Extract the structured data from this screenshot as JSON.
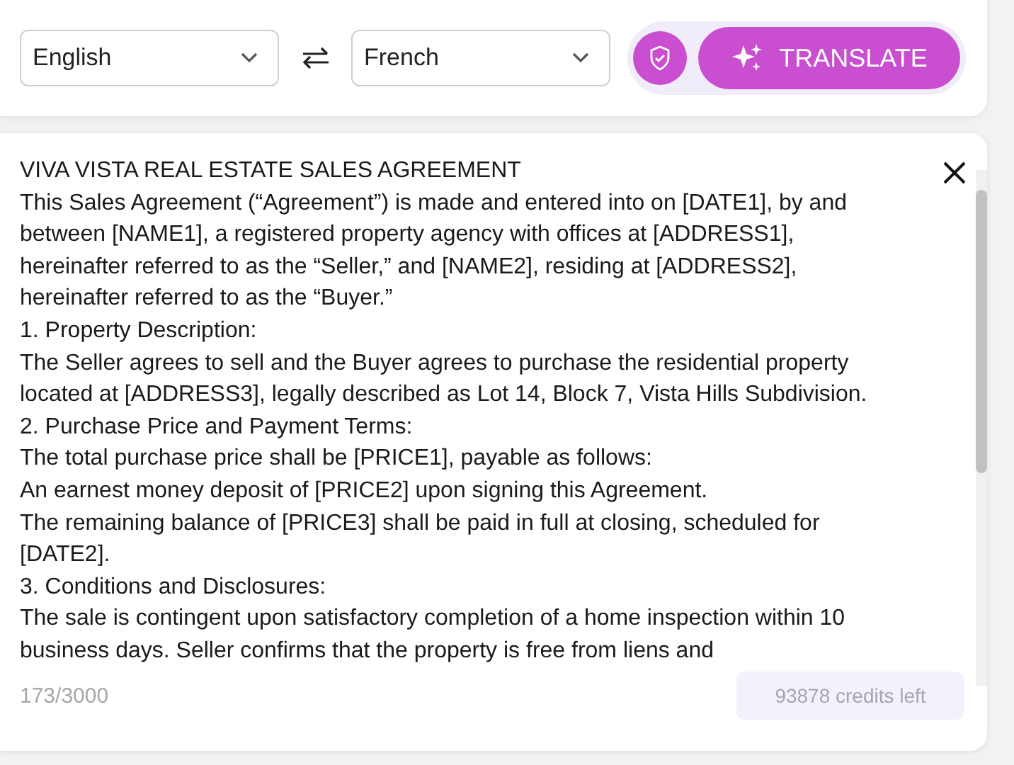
{
  "source_language": {
    "value": "English"
  },
  "target_language": {
    "value": "French"
  },
  "translate_button": {
    "label": "TRANSLATE"
  },
  "document": {
    "paragraphs": [
      "VIVA VISTA REAL ESTATE SALES AGREEMENT",
      "This Sales Agreement (“Agreement”) is made and entered into on [DATE1], by and between [NAME1], a registered property agency with offices at [ADDRESS1], hereinafter referred to as the “Seller,” and [NAME2], residing at [ADDRESS2], hereinafter referred to as the “Buyer.”",
      "1. Property Description:",
      "The Seller agrees to sell and the Buyer agrees to purchase the residential property located at [ADDRESS3], legally described as Lot 14, Block 7, Vista Hills Subdivision.",
      "2. Purchase Price and Payment Terms:",
      "The total purchase price shall be [PRICE1], payable as follows:",
      "An earnest money deposit of [PRICE2] upon signing this Agreement.",
      "The remaining balance of [PRICE3] shall be paid in full at closing, scheduled for [DATE2].",
      "3. Conditions and Disclosures:",
      "The sale is contingent upon satisfactory completion of a home inspection within 10 business days. Seller confirms that the property is free from liens and"
    ]
  },
  "char_count": "173/3000",
  "credits": "93878 credits left"
}
